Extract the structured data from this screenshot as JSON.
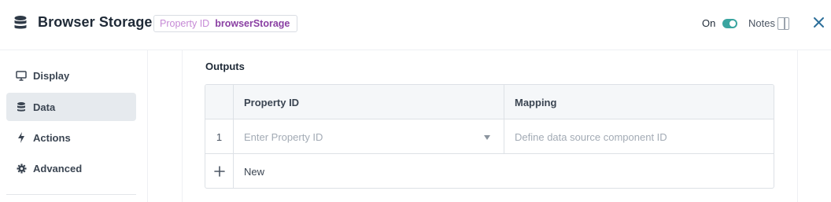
{
  "header": {
    "title": "Browser Storage",
    "property_chip": {
      "key": "Property ID",
      "value": "browserStorage"
    },
    "toggle_label": "On",
    "toggle_on": true,
    "notes_label": "Notes",
    "icons": {
      "app": "database-icon",
      "notes": "panel-icon",
      "close": "close-icon"
    },
    "colors": {
      "accent": "#3aa5a0",
      "chip_key": "#c68ad6",
      "chip_value": "#8a3fa3"
    }
  },
  "sidebar": {
    "items": [
      {
        "label": "Display",
        "icon": "monitor-icon",
        "active": false
      },
      {
        "label": "Data",
        "icon": "database-icon",
        "active": true
      },
      {
        "label": "Actions",
        "icon": "lightning-icon",
        "active": false
      },
      {
        "label": "Advanced",
        "icon": "gear-icon",
        "active": false
      }
    ]
  },
  "main": {
    "section_title": "Outputs",
    "table": {
      "headers": [
        "Property ID",
        "Mapping"
      ],
      "rows": [
        {
          "index": "1",
          "property_placeholder": "Enter Property ID",
          "mapping_placeholder": "Define data source component ID"
        }
      ],
      "add_label": "New"
    }
  }
}
